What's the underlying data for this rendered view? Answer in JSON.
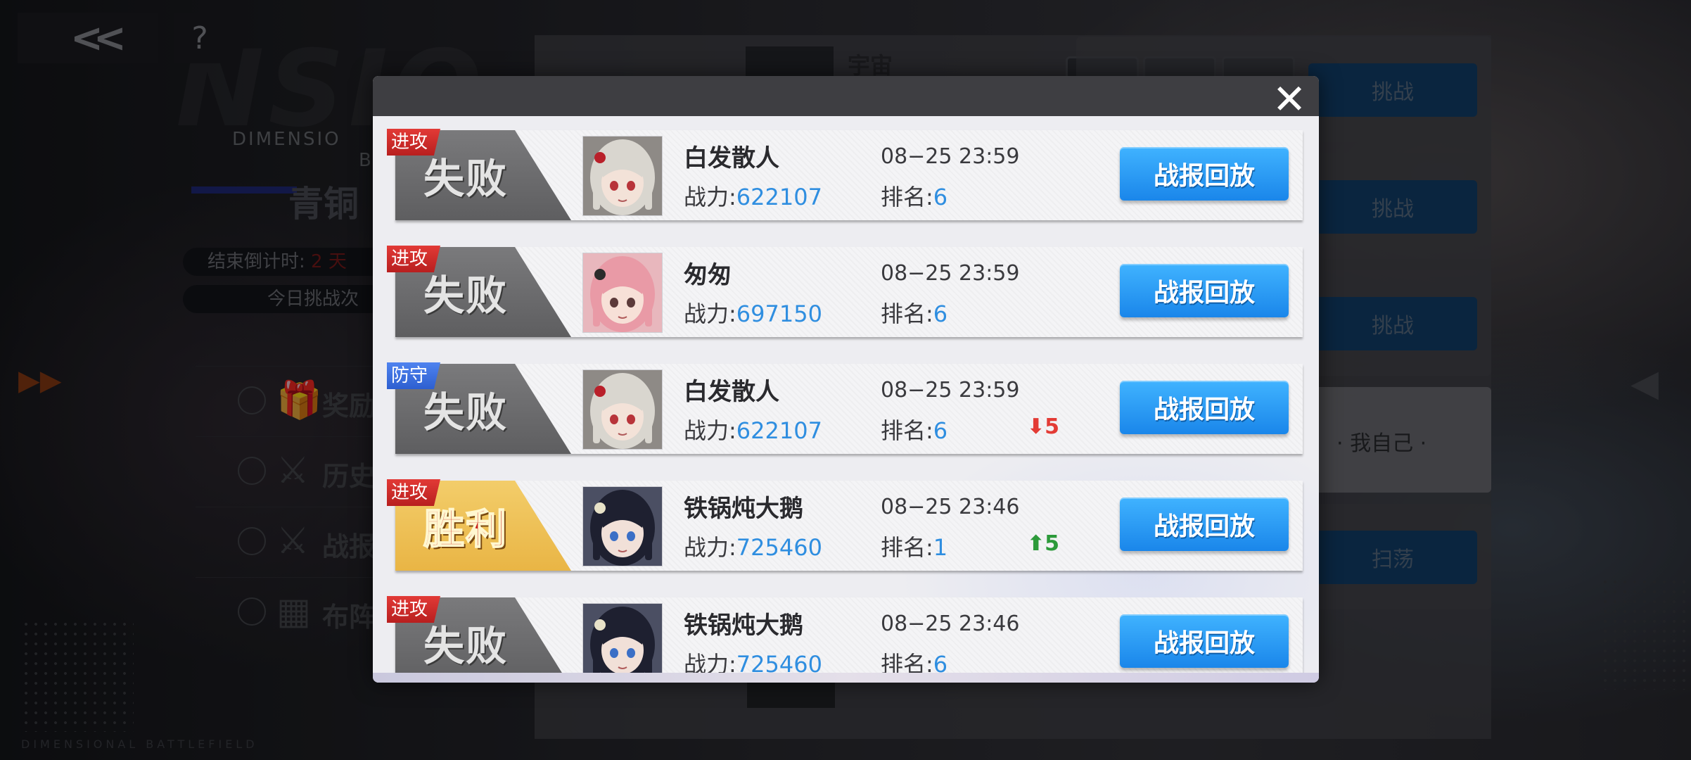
{
  "background": {
    "faded_word": "NSIO",
    "subtitle": "DIMENSIO",
    "subtitle2": "BA",
    "rank_title": "青铜",
    "countdown_label": "结束倒计时:",
    "countdown_value": "2 天",
    "daily_challenges": "今日挑战次",
    "menu": [
      {
        "label": "奖励",
        "icon": "gift-icon"
      },
      {
        "label": "历史",
        "icon": "crossed-swords-icon"
      },
      {
        "label": "战报",
        "icon": "crossed-swords-icon"
      },
      {
        "label": "布阵",
        "icon": "grid-icon"
      }
    ],
    "footer": "DIMENSIONAL BATTLEFIELD",
    "opponents": {
      "top_name": "宇宙",
      "buttons": [
        "挑战",
        "挑战",
        "挑战",
        "扫荡"
      ],
      "self_label": "· 我自己 ·"
    }
  },
  "modal": {
    "close_icon": "close-icon",
    "records": [
      {
        "tag": "进攻",
        "tag_type": "attack",
        "result": "失败",
        "result_type": "fail",
        "name": "白发散人",
        "power_label": "战力:",
        "power": "622107",
        "datetime": "08−25 23:59",
        "rank_label": "排名:",
        "rank": "6",
        "change": "",
        "change_dir": "",
        "replay": "战报回放",
        "avatar": "white-hair"
      },
      {
        "tag": "进攻",
        "tag_type": "attack",
        "result": "失败",
        "result_type": "fail",
        "name": "匆匆",
        "power_label": "战力:",
        "power": "697150",
        "datetime": "08−25 23:59",
        "rank_label": "排名:",
        "rank": "6",
        "change": "",
        "change_dir": "",
        "replay": "战报回放",
        "avatar": "pink-hair"
      },
      {
        "tag": "防守",
        "tag_type": "defend",
        "result": "失败",
        "result_type": "fail",
        "name": "白发散人",
        "power_label": "战力:",
        "power": "622107",
        "datetime": "08−25 23:59",
        "rank_label": "排名:",
        "rank": "6",
        "change": "⬇5",
        "change_dir": "down",
        "replay": "战报回放",
        "avatar": "white-hair"
      },
      {
        "tag": "进攻",
        "tag_type": "attack",
        "result": "胜利",
        "result_type": "win",
        "name": "铁锅炖大鹅",
        "power_label": "战力:",
        "power": "725460",
        "datetime": "08−25 23:46",
        "rank_label": "排名:",
        "rank": "1",
        "change": "⬆5",
        "change_dir": "up",
        "replay": "战报回放",
        "avatar": "black-hair"
      },
      {
        "tag": "进攻",
        "tag_type": "attack",
        "result": "失败",
        "result_type": "fail",
        "name": "铁锅炖大鹅",
        "power_label": "战力:",
        "power": "725460",
        "datetime": "08−25 23:46",
        "rank_label": "排名:",
        "rank": "6",
        "change": "",
        "change_dir": "",
        "replay": "战报回放",
        "avatar": "black-hair"
      }
    ]
  },
  "colors": {
    "accent_blue": "#2f8ee0",
    "attack_red": "#d6302c",
    "defend_blue": "#3f72e0",
    "win_gold": "#efc25a",
    "rank_down": "#e33b35",
    "rank_up": "#2c9a3a"
  }
}
